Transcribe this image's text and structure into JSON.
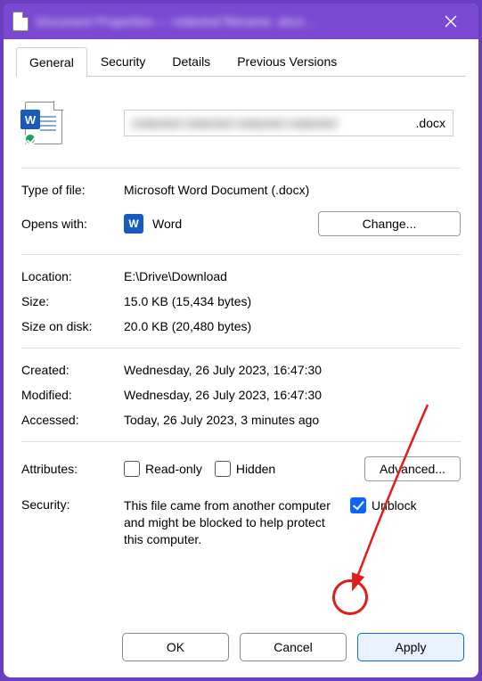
{
  "titlebar": {
    "title": "Document Properties — redacted filename .docx ...",
    "close_label": "Close"
  },
  "tabs": {
    "general": "General",
    "security": "Security",
    "details": "Details",
    "previous_versions": "Previous Versions"
  },
  "file": {
    "extension": ".docx",
    "name_redacted": "redacted redacted redacted redacted"
  },
  "fields": {
    "type_of_file_label": "Type of file:",
    "type_of_file_value": "Microsoft Word Document (.docx)",
    "opens_with_label": "Opens with:",
    "opens_with_app": "Word",
    "change_button": "Change...",
    "location_label": "Location:",
    "location_value": "E:\\Drive\\Download",
    "size_label": "Size:",
    "size_value": "15.0 KB (15,434 bytes)",
    "size_on_disk_label": "Size on disk:",
    "size_on_disk_value": "20.0 KB (20,480 bytes)",
    "created_label": "Created:",
    "created_value": "Wednesday, 26 July 2023, 16:47:30",
    "modified_label": "Modified:",
    "modified_value": "Wednesday, 26 July 2023, 16:47:30",
    "accessed_label": "Accessed:",
    "accessed_value": "Today, 26 July 2023, 3 minutes ago",
    "attributes_label": "Attributes:",
    "read_only": "Read-only",
    "hidden": "Hidden",
    "advanced_button": "Advanced...",
    "security_label": "Security:",
    "security_text": "This file came from another computer and might be blocked to help protect this computer.",
    "unblock": "Unblock"
  },
  "footer": {
    "ok": "OK",
    "cancel": "Cancel",
    "apply": "Apply"
  }
}
